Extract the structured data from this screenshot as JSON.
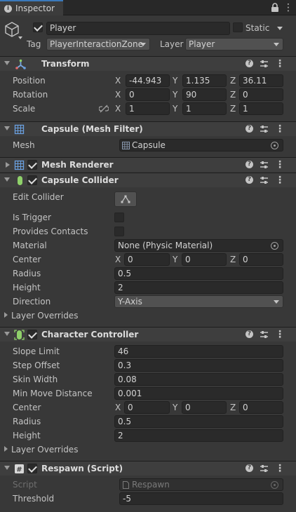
{
  "tab": {
    "title": "Inspector",
    "lock_icon": "lock-icon",
    "menu_icon": "kebab-menu-icon"
  },
  "object": {
    "active": true,
    "name": "Player",
    "static_label": "Static",
    "static": false,
    "tag_label": "Tag",
    "tag": "PlayerInteractionZone",
    "layer_label": "Layer",
    "layer": "Player"
  },
  "transform": {
    "title": "Transform",
    "position_label": "Position",
    "position": {
      "x": "-44.943",
      "y": "1.135",
      "z": "36.11"
    },
    "rotation_label": "Rotation",
    "rotation": {
      "x": "0",
      "y": "90",
      "z": "0"
    },
    "scale_label": "Scale",
    "scale": {
      "x": "1",
      "y": "1",
      "z": "1"
    }
  },
  "axes": {
    "x": "X",
    "y": "Y",
    "z": "Z"
  },
  "mesh_filter": {
    "title": "Capsule (Mesh Filter)",
    "mesh_label": "Mesh",
    "mesh": "Capsule"
  },
  "mesh_renderer": {
    "title": "Mesh Renderer",
    "enabled": true
  },
  "capsule_collider": {
    "title": "Capsule Collider",
    "enabled": true,
    "edit_label": "Edit Collider",
    "is_trigger_label": "Is Trigger",
    "is_trigger": false,
    "provides_contacts_label": "Provides Contacts",
    "provides_contacts": false,
    "material_label": "Material",
    "material": "None (Physic Material)",
    "center_label": "Center",
    "center": {
      "x": "0",
      "y": "0",
      "z": "0"
    },
    "radius_label": "Radius",
    "radius": "0.5",
    "height_label": "Height",
    "height": "2",
    "direction_label": "Direction",
    "direction": "Y-Axis",
    "layer_overrides": "Layer Overrides"
  },
  "character_controller": {
    "title": "Character Controller",
    "enabled": true,
    "slope_label": "Slope Limit",
    "slope": "46",
    "step_label": "Step Offset",
    "step": "0.3",
    "skin_label": "Skin Width",
    "skin": "0.08",
    "minmove_label": "Min Move Distance",
    "minmove": "0.001",
    "center_label": "Center",
    "center": {
      "x": "0",
      "y": "0",
      "z": "0"
    },
    "radius_label": "Radius",
    "radius": "0.5",
    "height_label": "Height",
    "height": "2",
    "layer_overrides": "Layer Overrides"
  },
  "respawn": {
    "title": "Respawn (Script)",
    "enabled": true,
    "script_label": "Script",
    "script": "Respawn",
    "threshold_label": "Threshold",
    "threshold": "-5"
  },
  "colors": {
    "panel": "#383838",
    "field": "#2a2a2a",
    "header": "#3e3e3e",
    "accent": "#3a79bb"
  }
}
